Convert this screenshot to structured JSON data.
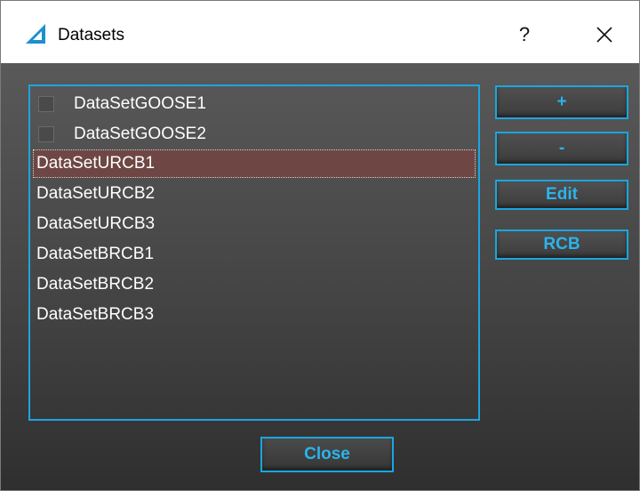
{
  "window": {
    "title": "Datasets",
    "help_label": "?",
    "close_label": "✕",
    "app_icon": "triangle-logo-icon"
  },
  "datasets": {
    "items": [
      {
        "label": "DataSetGOOSE1",
        "has_checkbox": true,
        "checked": false,
        "selected": false
      },
      {
        "label": "DataSetGOOSE2",
        "has_checkbox": true,
        "checked": false,
        "selected": false
      },
      {
        "label": "DataSetURCB1",
        "has_checkbox": false,
        "selected": true
      },
      {
        "label": "DataSetURCB2",
        "has_checkbox": false,
        "selected": false
      },
      {
        "label": "DataSetURCB3",
        "has_checkbox": false,
        "selected": false
      },
      {
        "label": "DataSetBRCB1",
        "has_checkbox": false,
        "selected": false
      },
      {
        "label": "DataSetBRCB2",
        "has_checkbox": false,
        "selected": false
      },
      {
        "label": "DataSetBRCB3",
        "has_checkbox": false,
        "selected": false
      }
    ]
  },
  "actions": {
    "add_label": "+",
    "remove_label": "-",
    "edit_label": "Edit",
    "rcb_label": "RCB"
  },
  "footer": {
    "close_label": "Close"
  },
  "colors": {
    "accent": "#1aa6df",
    "button_text": "#2ab4ec",
    "selection": "#6e4744",
    "background_top": "#595959",
    "background_bottom": "#2f2f2f"
  }
}
